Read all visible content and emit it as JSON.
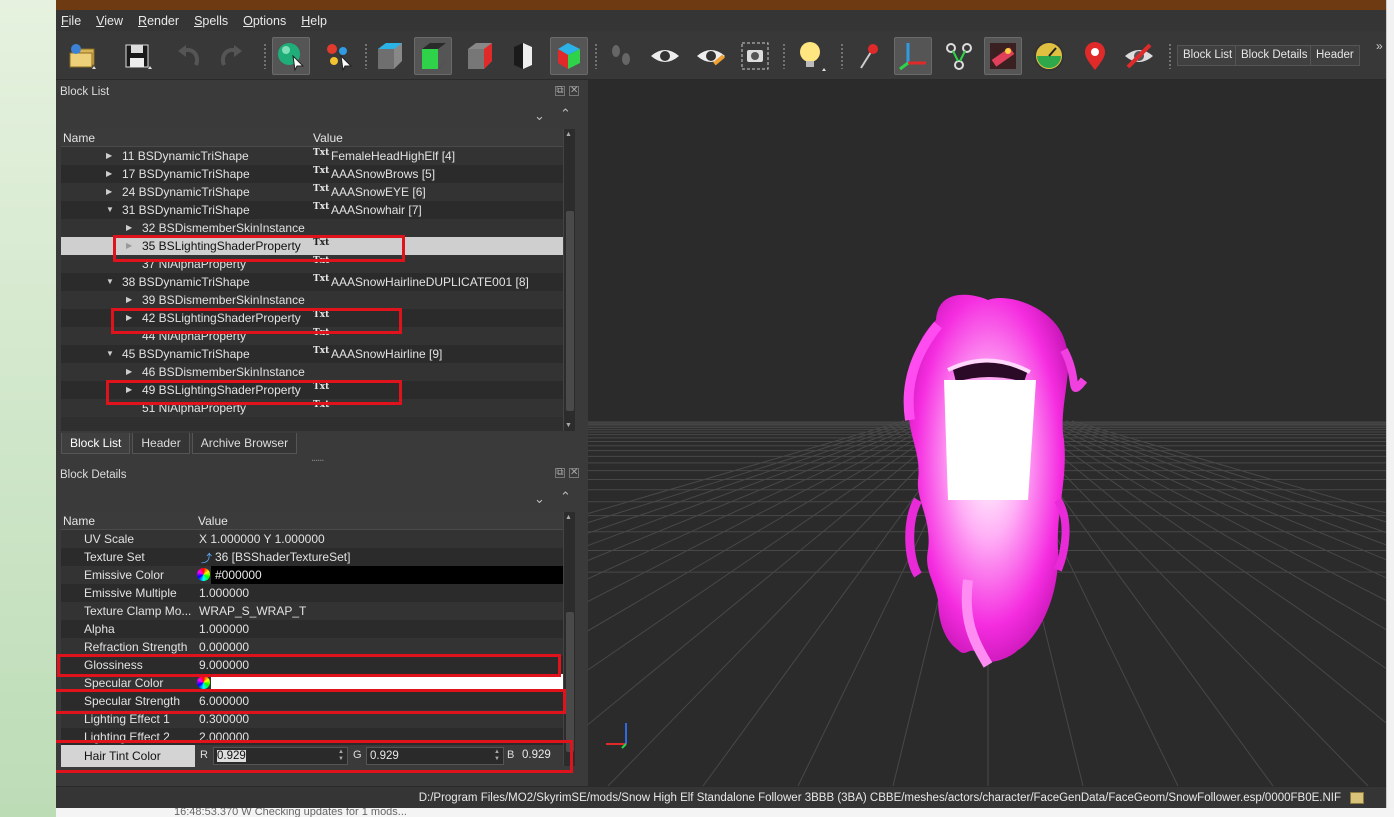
{
  "menu": [
    "File",
    "View",
    "Render",
    "Spells",
    "Options",
    "Help"
  ],
  "toolbar": {
    "text_buttons": [
      "Block List",
      "Block Details",
      "Header"
    ],
    "icons": [
      "load-icon",
      "save-icon",
      "undo-icon",
      "redo-icon",
      "select-object-icon",
      "select-vertex-icon",
      "cube-shaded-icon",
      "cube-green-icon",
      "cube-red-icon",
      "cube-flat-icon",
      "cube-rgb-icon",
      "footprints-icon",
      "eye-icon",
      "eye-edit-icon",
      "screenshot-icon",
      "light-bulb-icon",
      "pin-icon",
      "axes-icon",
      "nodes-icon",
      "texture-icon",
      "gauge-icon",
      "location-icon",
      "hide-icon"
    ]
  },
  "block_list": {
    "title": "Block List",
    "col_name": "Name",
    "col_value": "Value",
    "rows": [
      {
        "name": "11 BSDynamicTriShape",
        "value": "FemaleHeadHighElf [4]",
        "indent": 1,
        "arrow": "right",
        "txt": true
      },
      {
        "name": "17 BSDynamicTriShape",
        "value": "AAASnowBrows [5]",
        "indent": 1,
        "arrow": "right",
        "txt": true
      },
      {
        "name": "24 BSDynamicTriShape",
        "value": "AAASnowEYE [6]",
        "indent": 1,
        "arrow": "right",
        "txt": true
      },
      {
        "name": "31 BSDynamicTriShape",
        "value": "AAASnowhair [7]",
        "indent": 1,
        "arrow": "down",
        "txt": true
      },
      {
        "name": "32 BSDismemberSkinInstance",
        "value": "",
        "indent": 2,
        "arrow": "right",
        "txt": false
      },
      {
        "name": "35 BSLightingShaderProperty",
        "value": "",
        "indent": 2,
        "arrow": "right",
        "txt": true,
        "selected": true
      },
      {
        "name": "37 NiAlphaProperty",
        "value": "",
        "indent": 2,
        "arrow": "",
        "txt": true
      },
      {
        "name": "38 BSDynamicTriShape",
        "value": "AAASnowHairlineDUPLICATE001 [8]",
        "indent": 1,
        "arrow": "down",
        "txt": true
      },
      {
        "name": "39 BSDismemberSkinInstance",
        "value": "",
        "indent": 2,
        "arrow": "right",
        "txt": false
      },
      {
        "name": "42 BSLightingShaderProperty",
        "value": "",
        "indent": 2,
        "arrow": "right",
        "txt": true
      },
      {
        "name": "44 NiAlphaProperty",
        "value": "",
        "indent": 2,
        "arrow": "",
        "txt": true
      },
      {
        "name": "45 BSDynamicTriShape",
        "value": "AAASnowHairline [9]",
        "indent": 1,
        "arrow": "down",
        "txt": true
      },
      {
        "name": "46 BSDismemberSkinInstance",
        "value": "",
        "indent": 2,
        "arrow": "right",
        "txt": false
      },
      {
        "name": "49 BSLightingShaderProperty",
        "value": "",
        "indent": 2,
        "arrow": "right",
        "txt": true
      },
      {
        "name": "51 NiAlphaProperty",
        "value": "",
        "indent": 2,
        "arrow": "",
        "txt": true
      }
    ],
    "txt_label": "Txt"
  },
  "tabs": [
    "Block List",
    "Header",
    "Archive Browser"
  ],
  "block_details": {
    "title": "Block Details",
    "col_name": "Name",
    "col_value": "Value",
    "rows": [
      {
        "name": "UV Scale",
        "value": "X 1.000000 Y 1.000000",
        "type": "text"
      },
      {
        "name": "Texture Set",
        "value": "36 [BSShaderTextureSet]",
        "type": "link"
      },
      {
        "name": "Emissive Color",
        "value": "#000000",
        "type": "color-black"
      },
      {
        "name": "Emissive Multiple",
        "value": "1.000000",
        "type": "text"
      },
      {
        "name": "Texture Clamp Mo...",
        "value": "WRAP_S_WRAP_T",
        "type": "text"
      },
      {
        "name": "Alpha",
        "value": "1.000000",
        "type": "text"
      },
      {
        "name": "Refraction Strength",
        "value": "0.000000",
        "type": "text"
      },
      {
        "name": "Glossiness",
        "value": "9.000000",
        "type": "text"
      },
      {
        "name": "Specular Color",
        "value": "",
        "type": "color-white"
      },
      {
        "name": "Specular Strength",
        "value": "6.000000",
        "type": "text"
      },
      {
        "name": "Lighting Effect 1",
        "value": "0.300000",
        "type": "text"
      },
      {
        "name": "Lighting Effect 2",
        "value": "2.000000",
        "type": "text"
      }
    ],
    "edit_row": {
      "label": "Hair Tint Color",
      "r_label": "R",
      "r_value": "0.929",
      "g_label": "G",
      "g_value": "0.929",
      "b_label": "B",
      "b_value": "0.929"
    }
  },
  "status": {
    "path": "D:/Program Files/MO2/SkyrimSE/mods/Snow High Elf Standalone Follower 3BBB (3BA) CBBE/meshes/actors/character/FaceGenData/FaceGeom/SnowFollower.esp/0000FB0E.NIF"
  },
  "background": {
    "log_text": "16:48:53.370   W   Checking updates for 1 mods..."
  },
  "colors": {
    "highlight_red": "#e0131d",
    "hair_magenta": "#ff2de8",
    "viewport_bg": "#2b2b2b"
  }
}
